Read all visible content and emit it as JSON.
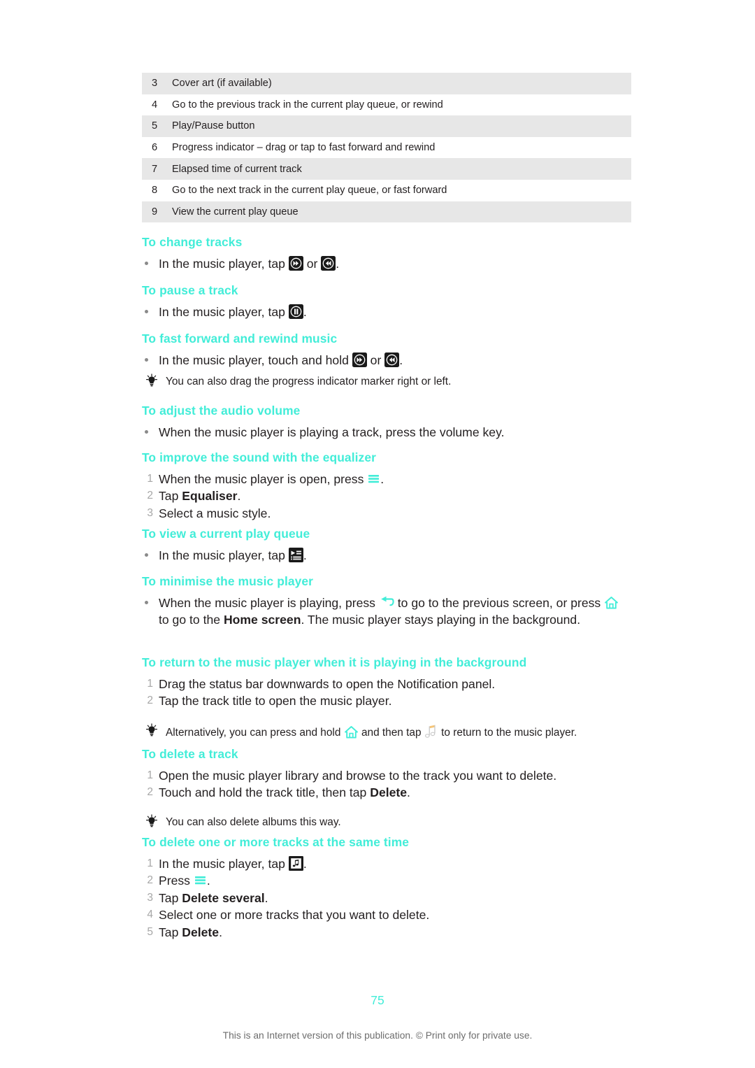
{
  "document": {
    "page_number": "75",
    "footer_note": "This is an Internet version of this publication. © Print only for private use.",
    "heading_color": "#42EDD8",
    "body_color": "#231f20",
    "row_shade_color": "#e7e7e7",
    "list_number_color": "#a7a7a7"
  },
  "reference_table": {
    "rows": [
      {
        "num": "3",
        "text": "Cover art (if available)"
      },
      {
        "num": "4",
        "text": "Go to the previous track in the current play queue, or rewind"
      },
      {
        "num": "5",
        "text": "Play/Pause button"
      },
      {
        "num": "6",
        "text": "Progress indicator – drag or tap to fast forward and rewind"
      },
      {
        "num": "7",
        "text": "Elapsed time of current track"
      },
      {
        "num": "8",
        "text": "Go to the next track in the current play queue, or fast forward"
      },
      {
        "num": "9",
        "text": "View the current play queue"
      }
    ]
  },
  "sections": {
    "change_tracks": {
      "heading": "To change tracks",
      "step1_a": "In the music player, tap ",
      "step1_b": " or ",
      "step1_c": ".",
      "icon_next": "next-track-icon",
      "icon_prev": "previous-track-icon"
    },
    "pause_track": {
      "heading": "To pause a track",
      "step1_a": "In the music player, tap ",
      "step1_b": ".",
      "icon_pause": "pause-icon"
    },
    "fast_forward_rewind": {
      "heading": "To fast forward and rewind music",
      "step1_a": "In the music player, touch and hold ",
      "step1_b": " or ",
      "step1_c": ".",
      "icon_next": "next-track-icon",
      "icon_prev": "previous-track-icon",
      "tip": "You can also drag the progress indicator marker right or left."
    },
    "adjust_volume": {
      "heading": "To adjust the audio volume",
      "step1": "When the music player is playing a track, press the volume key."
    },
    "equalizer": {
      "heading": "To improve the sound with the equalizer",
      "step1_a": "When the music player is open, press ",
      "step1_b": ".",
      "icon_menu": "menu-icon",
      "step2_a": "Tap ",
      "step2_bold": "Equaliser",
      "step2_b": ".",
      "step3": "Select a music style."
    },
    "view_play_queue": {
      "heading": "To view a current play queue",
      "step1_a": "In the music player, tap ",
      "step1_b": ".",
      "icon_queue": "play-queue-icon"
    },
    "minimise_player": {
      "heading": "To minimise the music player",
      "step1_a": "When the music player is playing, press ",
      "step1_b": " to go to the previous screen, or press ",
      "step1_c": " to go to the ",
      "step1_bold": "Home screen",
      "step1_d": ". The music player stays playing in the background.",
      "icon_back": "back-icon",
      "icon_home": "home-icon"
    },
    "return_to_player": {
      "heading": "To return to the music player when it is playing in the background",
      "step1": "Drag the status bar downwards to open the Notification panel.",
      "step2": "Tap the track title to open the music player.",
      "tip_a": "Alternatively, you can press and hold ",
      "tip_b": " and then tap ",
      "tip_c": " to return to the music player.",
      "icon_home": "home-icon",
      "icon_music_note": "music-note-icon"
    },
    "delete_track": {
      "heading": "To delete a track",
      "step1": "Open the music player library and browse to the track you want to delete.",
      "step2_a": "Touch and hold the track title, then tap ",
      "step2_bold": "Delete",
      "step2_b": ".",
      "tip": "You can also delete albums this way."
    },
    "delete_multiple": {
      "heading": "To delete one or more tracks at the same time",
      "step1_a": "In the music player, tap ",
      "step1_b": ".",
      "icon_note": "music-note-button-icon",
      "step2_a": "Press ",
      "step2_b": ".",
      "icon_menu": "menu-icon",
      "step3_a": "Tap ",
      "step3_bold": "Delete several",
      "step3_b": ".",
      "step4": "Select one or more tracks that you want to delete.",
      "step5_a": "Tap ",
      "step5_bold": "Delete",
      "step5_b": "."
    }
  }
}
